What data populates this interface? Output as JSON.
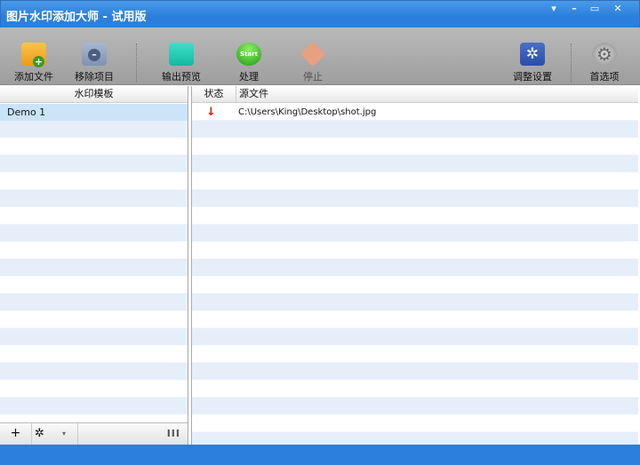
{
  "window": {
    "title": "图片水印添加大师 - 试用版",
    "menu": "▾",
    "minimize": "–",
    "maximize": "▭",
    "close": "✕"
  },
  "toolbar": [
    {
      "id": "add-file",
      "label": "添加文件"
    },
    {
      "id": "remove-item",
      "label": "移除项目"
    },
    {
      "id": "output-preview",
      "label": "输出预览"
    },
    {
      "id": "process",
      "label": "处理",
      "icon_text": "Start"
    },
    {
      "id": "stop",
      "label": "停止"
    },
    {
      "id": "adjust-settings",
      "label": "调整设置"
    },
    {
      "id": "preferences",
      "label": "首选项"
    }
  ],
  "templates": {
    "header": "水印模板",
    "items": [
      "Demo 1"
    ],
    "add": "+",
    "settings": "✲",
    "dropdown": "▾",
    "columns": "III"
  },
  "files": {
    "columns": [
      "状态",
      "源文件"
    ],
    "rows": [
      {
        "status": "↓",
        "path": "C:\\Users\\King\\Desktop\\shot.jpg"
      }
    ]
  },
  "colors": {
    "titlebar": "#2a80dc",
    "selected": "#cce4f8",
    "stripe": "#e6eefa"
  }
}
